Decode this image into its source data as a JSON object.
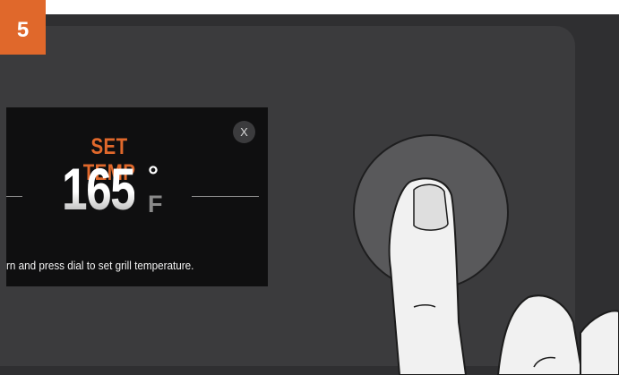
{
  "step": {
    "number": "5"
  },
  "display": {
    "heading": "SET TEMP",
    "temperature": "165",
    "degree_symbol": "°",
    "unit": "F",
    "close_label": "X",
    "instruction": "rn and press dial to set grill temperature."
  },
  "colors": {
    "accent": "#e0682b",
    "screen_bg": "#0f0f10",
    "dial": "#59595b",
    "panel": "#3b3b3d"
  },
  "icons": {
    "close": "close-icon",
    "hand": "pointing-finger-icon"
  }
}
